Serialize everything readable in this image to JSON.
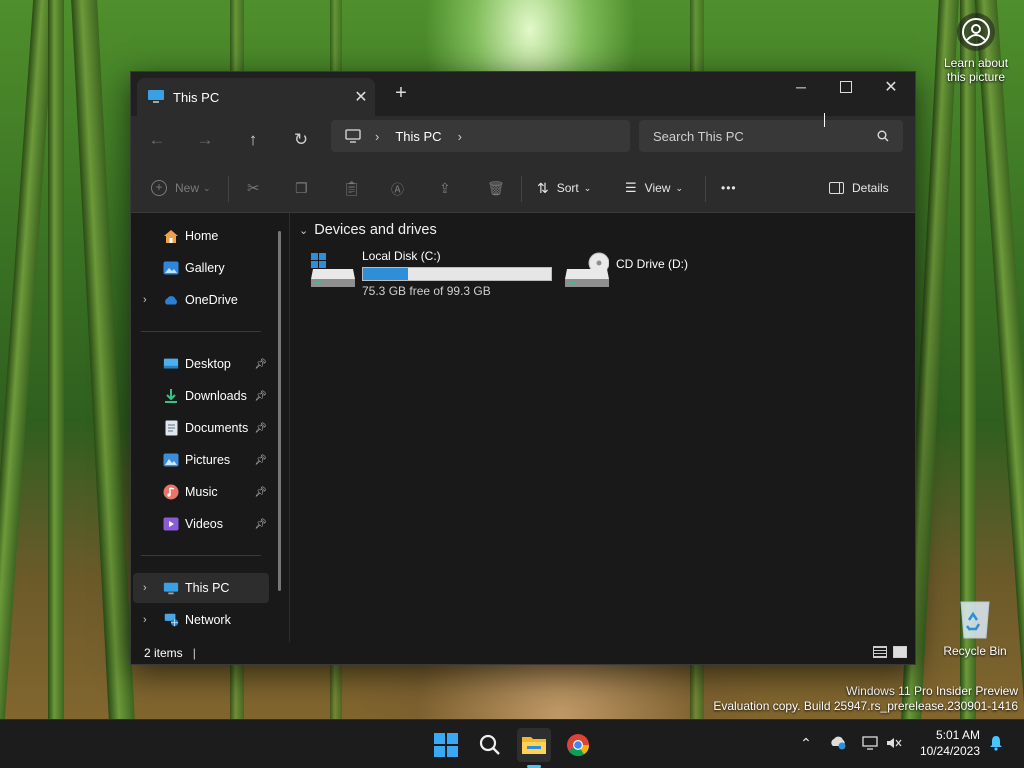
{
  "desktop": {
    "learn_about": "Learn about this picture",
    "recycle_bin": "Recycle Bin",
    "watermark_line1": "Windows 11 Pro Insider Preview",
    "watermark_line2": "Evaluation copy. Build 25947.rs_prerelease.230901-1416"
  },
  "window": {
    "tab_title": "This PC",
    "new_tab_symbol": "+",
    "address_crumb": "This PC",
    "search_placeholder": "Search This PC"
  },
  "commands": {
    "new": "New",
    "sort": "Sort",
    "view": "View",
    "more": "•••",
    "details": "Details"
  },
  "nav": {
    "items": [
      {
        "label": "Home",
        "icon": "home-icon"
      },
      {
        "label": "Gallery",
        "icon": "gallery-icon"
      },
      {
        "label": "OneDrive",
        "icon": "onedrive-icon"
      },
      {
        "label": "Desktop",
        "icon": "desktop-folder-icon"
      },
      {
        "label": "Downloads",
        "icon": "downloads-icon"
      },
      {
        "label": "Documents",
        "icon": "documents-icon"
      },
      {
        "label": "Pictures",
        "icon": "pictures-icon"
      },
      {
        "label": "Music",
        "icon": "music-icon"
      },
      {
        "label": "Videos",
        "icon": "videos-icon"
      },
      {
        "label": "This PC",
        "icon": "this-pc-icon"
      },
      {
        "label": "Network",
        "icon": "network-icon"
      }
    ]
  },
  "content": {
    "group_title": "Devices and drives",
    "drives": [
      {
        "name": "Local Disk (C:)",
        "free_text": "75.3 GB free of 99.3 GB",
        "used_fraction": 0.24
      },
      {
        "name": "CD Drive (D:)"
      }
    ]
  },
  "status": {
    "items": "2 items"
  },
  "taskbar": {
    "time": "5:01 AM",
    "date": "10/24/2023"
  },
  "colors": {
    "accent": "#2f8ed8",
    "window_bg": "#191919",
    "toolbar_bg": "#2c2c2c"
  }
}
